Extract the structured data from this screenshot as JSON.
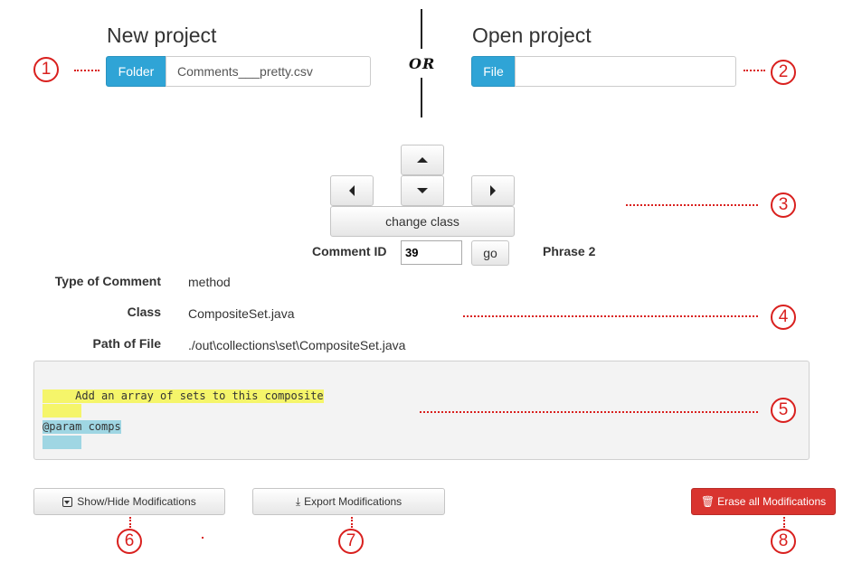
{
  "new_project": {
    "title": "New project",
    "folder_button": "Folder",
    "file_name": "Comments___pretty.csv"
  },
  "separator": {
    "text": "OR"
  },
  "open_project": {
    "title": "Open project",
    "file_button": "File",
    "file_value": ""
  },
  "navigation": {
    "up_icon": "caret-up-icon",
    "down_icon": "caret-down-icon",
    "left_icon": "caret-left-icon",
    "right_icon": "caret-right-icon",
    "change_class_label": "change class"
  },
  "comment_selector": {
    "label": "Comment ID",
    "value": "39",
    "go_label": "go",
    "phrase": "Phrase 2"
  },
  "details": {
    "type_label": "Type of Comment",
    "type_value": "method",
    "class_label": "Class",
    "class_value": "CompositeSet.java",
    "path_label": "Path of File",
    "path_value": "./out\\collections\\set\\CompositeSet.java"
  },
  "comment_box": {
    "line1": "     Add an array of sets to this composite",
    "line3": "@param comps"
  },
  "actions": {
    "show_hide_label": "Show/Hide Modifications",
    "export_label": "Export Modifications",
    "erase_label": "Erase all Modifications",
    "erase_color": "#d9342f"
  },
  "annotations": [
    "1",
    "2",
    "3",
    "4",
    "5",
    "6",
    "7",
    "8"
  ],
  "colors": {
    "accent_blue": "#2fa4d6",
    "annotation_red": "#d9201e",
    "highlight_yellow": "#f5f56a",
    "highlight_blue": "#9fd6e3"
  }
}
